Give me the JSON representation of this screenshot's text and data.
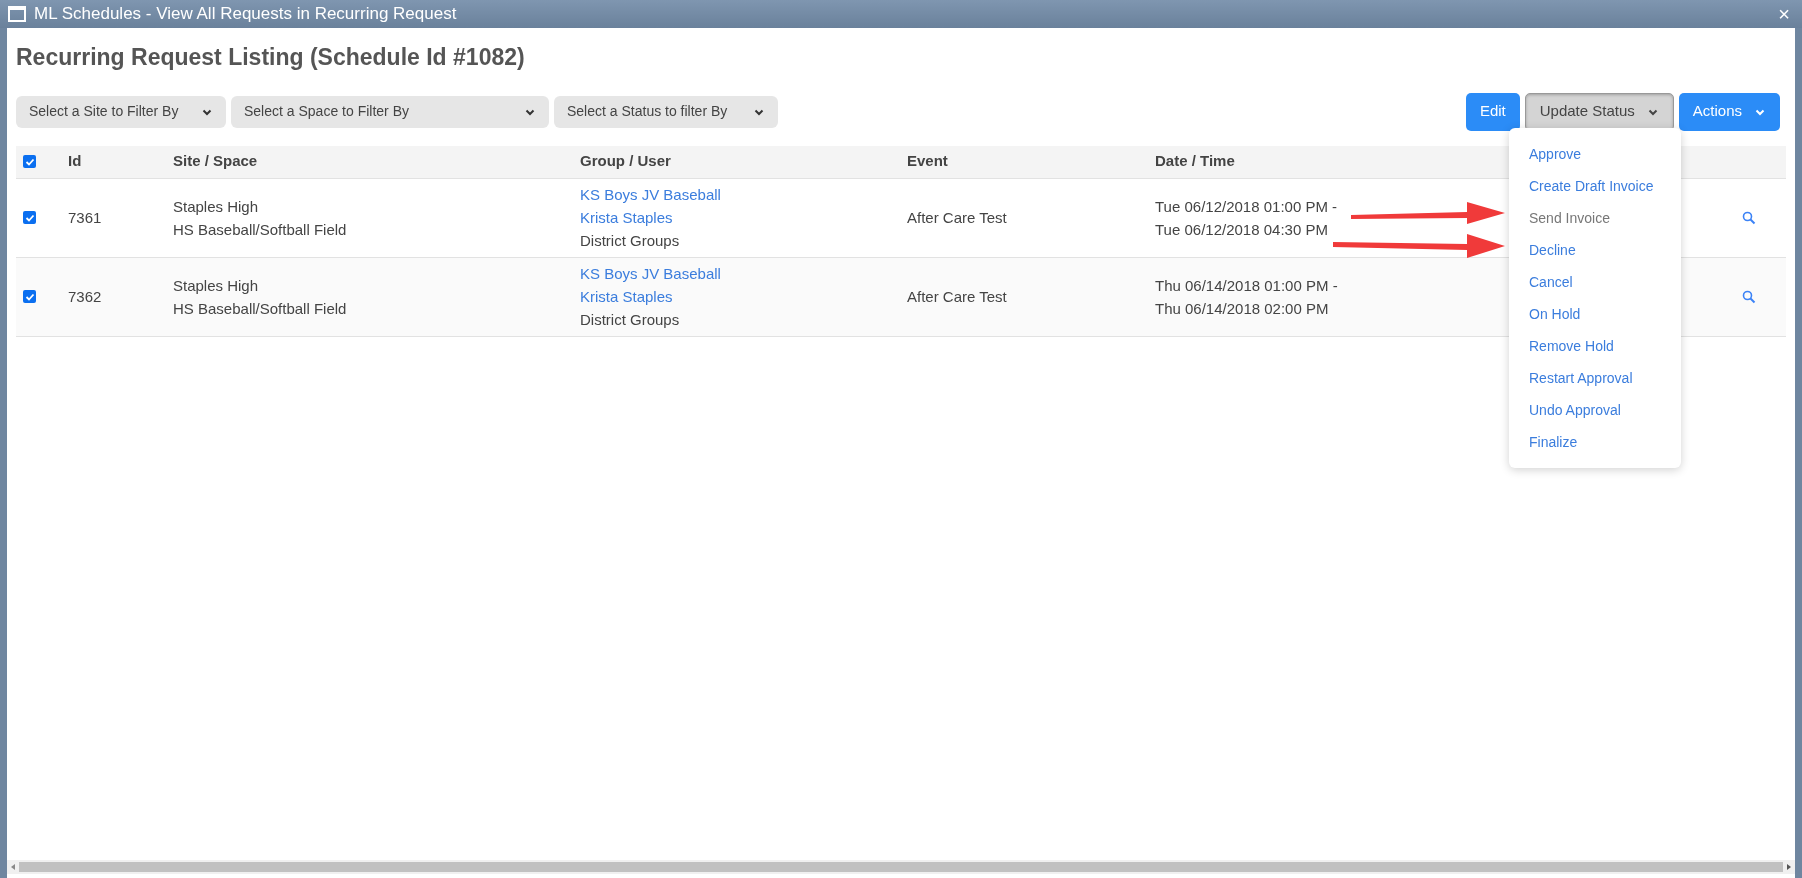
{
  "window": {
    "title": "ML Schedules - View All Requests in Recurring Request",
    "close": "×"
  },
  "heading": "Recurring Request Listing (Schedule Id #1082)",
  "filters": [
    {
      "placeholder": "Select a Site to Filter By"
    },
    {
      "placeholder": "Select a Space to Filter By"
    },
    {
      "placeholder": "Select a Status to filter By"
    }
  ],
  "buttons": [
    {
      "label": "Edit",
      "kind": "primary",
      "expanded": false
    },
    {
      "label": "Update Status",
      "kind": "secondary",
      "expanded": true
    },
    {
      "label": "Actions",
      "kind": "primary",
      "expanded": false
    }
  ],
  "status_menu": [
    {
      "label": "Approve",
      "disabled": false
    },
    {
      "label": "Create Draft Invoice",
      "disabled": false
    },
    {
      "label": "Send Invoice",
      "disabled": true
    },
    {
      "label": "Decline",
      "disabled": false
    },
    {
      "label": "Cancel",
      "disabled": false
    },
    {
      "label": "On Hold",
      "disabled": false
    },
    {
      "label": "Remove Hold",
      "disabled": false
    },
    {
      "label": "Restart Approval",
      "disabled": false
    },
    {
      "label": "Undo Approval",
      "disabled": false
    },
    {
      "label": "Finalize",
      "disabled": false
    }
  ],
  "table": {
    "select_all": {
      "checked": true
    },
    "columns": [
      "Id",
      "Site / Space",
      "Group / User",
      "Event",
      "Date / Time"
    ],
    "rows": [
      {
        "checked": true,
        "id": "7361",
        "site": "Staples High",
        "space": "HS Baseball/Softball Field",
        "group": "KS Boys JV Baseball",
        "user": "Krista Staples",
        "category": "District Groups",
        "event": "After Care Test",
        "start": "Tue 06/12/2018 01:00 PM -",
        "end": "Tue 06/12/2018 04:30 PM"
      },
      {
        "checked": true,
        "id": "7362",
        "site": "Staples High",
        "space": "HS Baseball/Softball Field",
        "group": "KS Boys JV Baseball",
        "user": "Krista Staples",
        "category": "District Groups",
        "event": "After Care Test",
        "start": "Thu 06/14/2018 01:00 PM -",
        "end": "Thu 06/14/2018 02:00 PM"
      }
    ]
  }
}
